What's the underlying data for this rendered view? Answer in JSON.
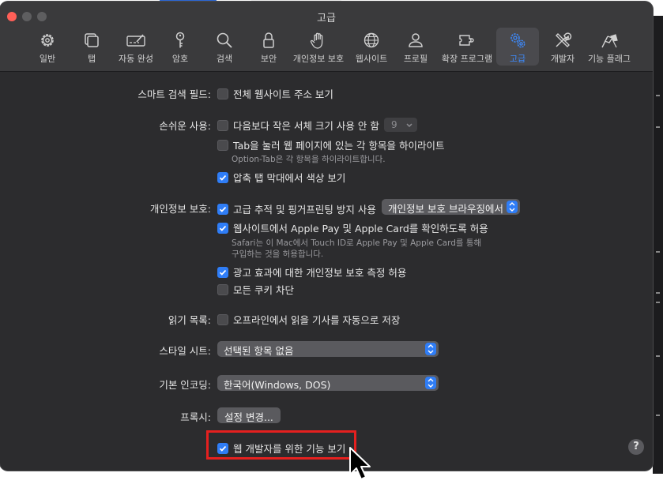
{
  "window": {
    "title": "고급"
  },
  "toolbar": {
    "items": [
      {
        "label": "일반",
        "icon": "gear-icon"
      },
      {
        "label": "탭",
        "icon": "tabs-icon"
      },
      {
        "label": "자동 완성",
        "icon": "autofill-icon"
      },
      {
        "label": "암호",
        "icon": "key-icon"
      },
      {
        "label": "검색",
        "icon": "search-icon"
      },
      {
        "label": "보안",
        "icon": "lock-icon"
      },
      {
        "label": "개인정보 보호",
        "icon": "hand-icon"
      },
      {
        "label": "웹사이트",
        "icon": "globe-icon"
      },
      {
        "label": "프로필",
        "icon": "person-icon"
      },
      {
        "label": "확장 프로그램",
        "icon": "puzzle-icon"
      },
      {
        "label": "고급",
        "icon": "gears-icon",
        "active": true
      },
      {
        "label": "개발자",
        "icon": "tools-icon"
      },
      {
        "label": "기능 플래그",
        "icon": "flags-icon"
      }
    ]
  },
  "smart_search": {
    "label": "스마트 검색 필드:",
    "show_full_address": {
      "text": "전체 웹사이트 주소 보기",
      "checked": false
    }
  },
  "accessibility": {
    "label": "손쉬운 사용:",
    "min_font": {
      "text": "다음보다 작은 서체 크기 사용 안 함",
      "checked": false,
      "value": "9"
    },
    "tab_highlight": {
      "text": "Tab을 눌러 웹 페이지에 있는 각 항목을 하이라이트",
      "checked": false
    },
    "tab_note": "Option-Tab은 각 항목을 하이라이트합니다.",
    "compact_color": {
      "text": "압축 탭 막대에서 색상 보기",
      "checked": true
    }
  },
  "privacy": {
    "label": "개인정보 보호:",
    "fingerprint": {
      "text": "고급 추적 및 핑거프린팅 방지 사용",
      "checked": true
    },
    "fingerprint_option": "개인정보 보호 브라우징에서",
    "apple_pay": {
      "text": "웹사이트에서 Apple Pay 및 Apple Card를 확인하도록 허용",
      "checked": true
    },
    "apple_pay_note_1": "Safari는 이 Mac에서 Touch ID로 Apple Pay 및 Apple Card를 통해",
    "apple_pay_note_2": "구입하는 것을 허용합니다.",
    "ad_measure": {
      "text": "광고 효과에 대한 개인정보 보호 측정 허용",
      "checked": true
    },
    "block_cookies": {
      "text": "모든 쿠키 차단",
      "checked": false
    }
  },
  "reading_list": {
    "label": "읽기 목록:",
    "offline": {
      "text": "오프라인에서 읽을 기사를 자동으로 저장",
      "checked": false
    }
  },
  "stylesheet": {
    "label": "스타일 시트:",
    "value": "선택된 항목 없음"
  },
  "encoding": {
    "label": "기본 인코딩:",
    "value": "한국어(Windows, DOS)"
  },
  "proxy": {
    "label": "프록시:",
    "button": "설정 변경..."
  },
  "developer": {
    "text": "웹 개발자를 위한 기능 보기",
    "checked": true
  },
  "help": {
    "text": "?"
  },
  "colors": {
    "accent": "#2f7df6",
    "highlight_box": "#e5201f",
    "window_bg": "#2c2c2e"
  }
}
